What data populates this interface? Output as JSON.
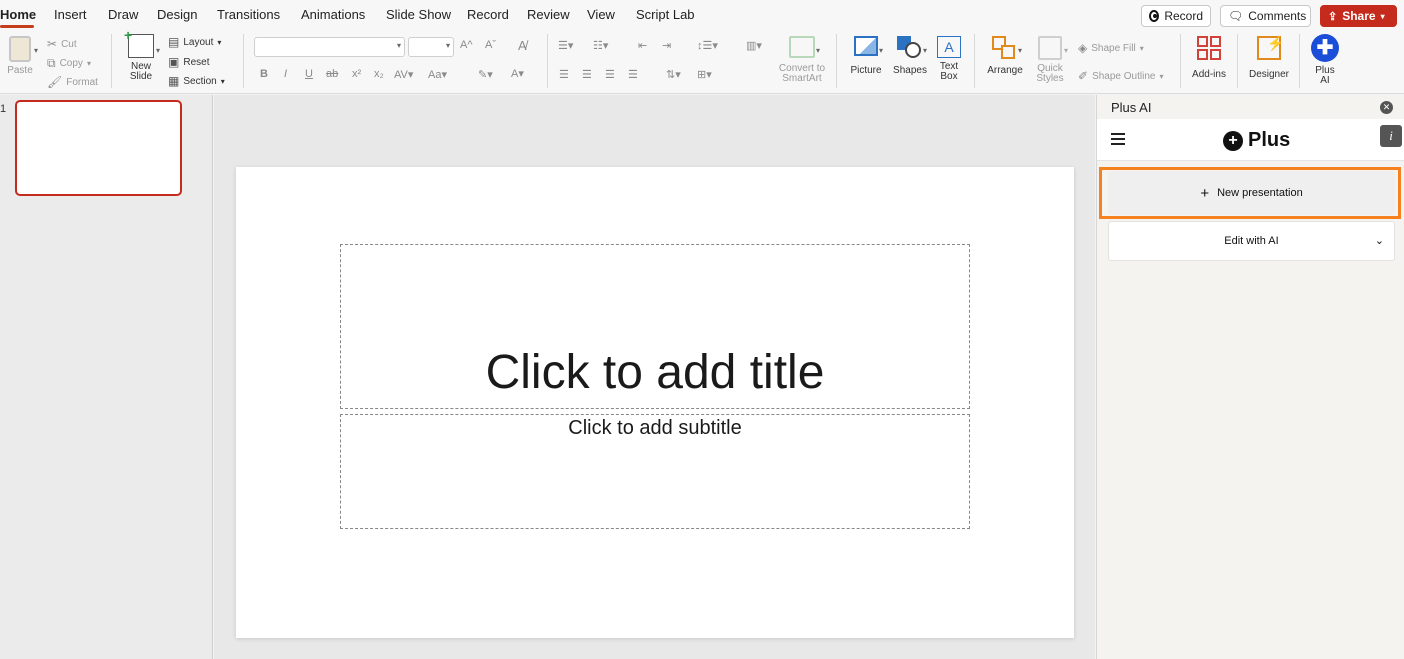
{
  "tabs": [
    {
      "label": "Home",
      "active": true
    },
    {
      "label": "Insert"
    },
    {
      "label": "Draw"
    },
    {
      "label": "Design"
    },
    {
      "label": "Transitions"
    },
    {
      "label": "Animations"
    },
    {
      "label": "Slide Show"
    },
    {
      "label": "Record"
    },
    {
      "label": "Review"
    },
    {
      "label": "View"
    },
    {
      "label": "Script Lab"
    }
  ],
  "top_buttons": {
    "record": "Record",
    "comments": "Comments",
    "share": "Share"
  },
  "ribbon": {
    "paste": "Paste",
    "cut": "Cut",
    "copy": "Copy",
    "format": "Format",
    "new_slide_1": "New",
    "new_slide_2": "Slide",
    "layout": "Layout",
    "reset": "Reset",
    "section": "Section",
    "convert_1": "Convert to",
    "convert_2": "SmartArt",
    "picture": "Picture",
    "shapes": "Shapes",
    "textbox_1": "Text",
    "textbox_2": "Box",
    "arrange": "Arrange",
    "quick_styles_1": "Quick",
    "quick_styles_2": "Styles",
    "shape_fill": "Shape Fill",
    "shape_outline": "Shape Outline",
    "addins": "Add-ins",
    "designer": "Designer",
    "plus_ai_1": "Plus",
    "plus_ai_2": "AI"
  },
  "thumbnails": {
    "slide_number": "1"
  },
  "slide": {
    "title_placeholder": "Click to add title",
    "subtitle_placeholder": "Click to add subtitle"
  },
  "pane": {
    "title": "Plus AI",
    "logo_text": "Plus",
    "new_presentation": "New presentation",
    "edit_with_ai": "Edit with AI"
  },
  "colors": {
    "accent": "#c43e1c",
    "highlight": "#f5821f",
    "plus_blue": "#1a4ed8"
  }
}
